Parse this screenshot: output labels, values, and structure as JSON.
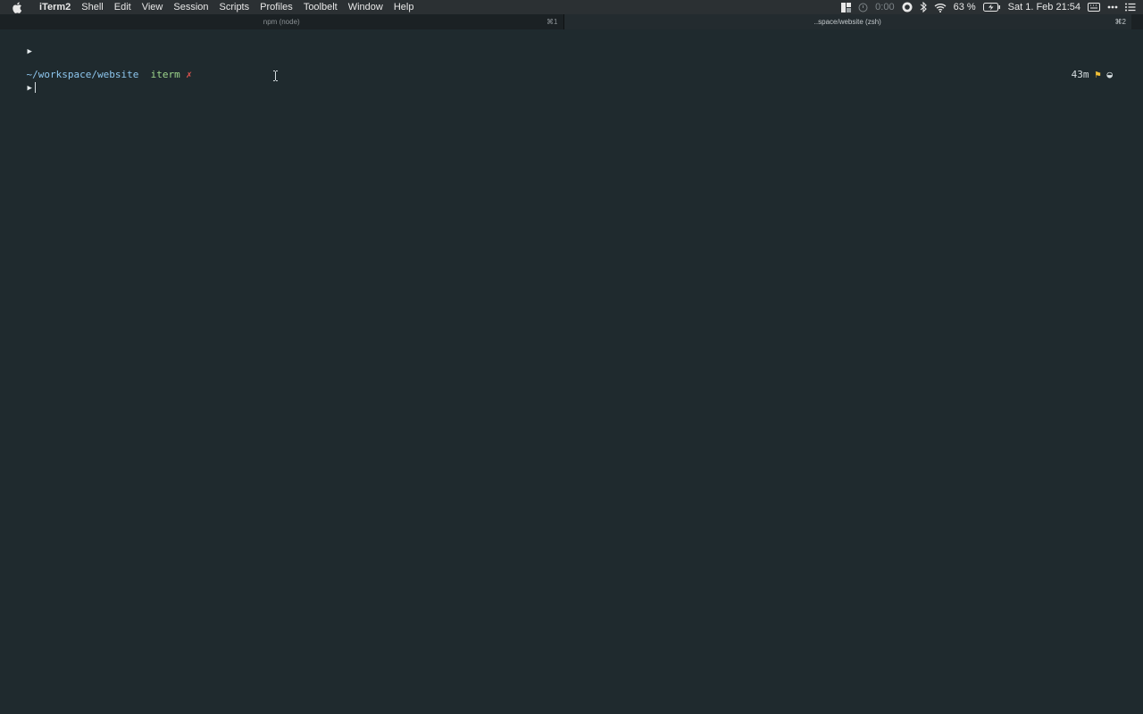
{
  "menubar": {
    "app_name": "iTerm2",
    "items": [
      "Shell",
      "Edit",
      "View",
      "Session",
      "Scripts",
      "Profiles",
      "Toolbelt",
      "Window",
      "Help"
    ],
    "timer": "0:00",
    "battery": "63 %",
    "datetime": "Sat 1. Feb  21:54"
  },
  "tabs": [
    {
      "title": "npm (node)",
      "shortcut": "⌘1",
      "active": false
    },
    {
      "title": "..space/website (zsh)",
      "shortcut": "⌘2",
      "active": true
    }
  ],
  "terminal": {
    "prompt_symbol": "▶",
    "path": "~/workspace/website",
    "git_branch": "iterm",
    "git_dirty": "✗",
    "elapsed": "43m",
    "flag": "⚑",
    "status_glyph": "◒"
  },
  "colors": {
    "background": "#1f2a2e",
    "path": "#8ec7ef",
    "branch": "#9fd88d",
    "dirty": "#e0544e",
    "flag": "#f2c037"
  }
}
